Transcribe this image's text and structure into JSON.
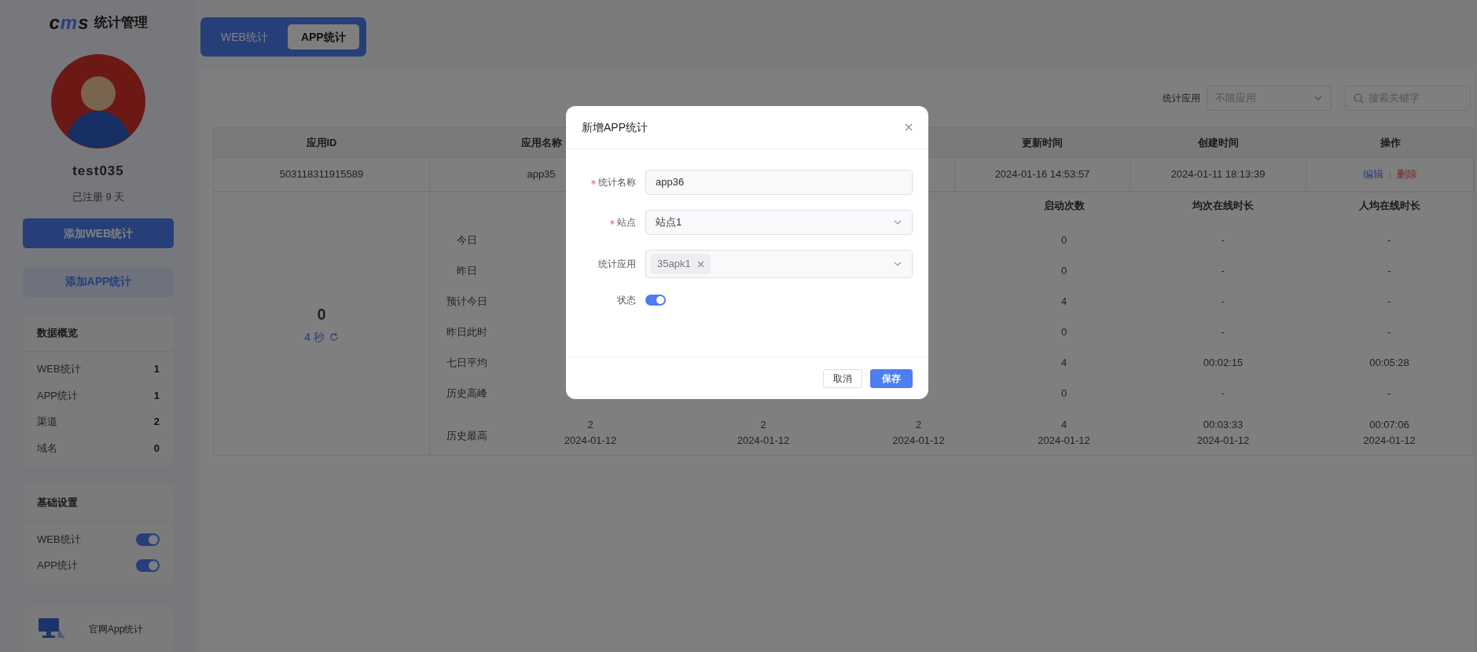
{
  "sidebar": {
    "logo": "cms",
    "title": "统计管理",
    "username": "test035",
    "registered": "已注册 9 天",
    "buttons": [
      {
        "label": "添加WEB统计",
        "kind": "primary"
      },
      {
        "label": "添加APP统计",
        "kind": "light"
      }
    ],
    "overview": {
      "title": "数据概览",
      "items": [
        {
          "label": "WEB统计",
          "value": "1"
        },
        {
          "label": "APP统计",
          "value": "1"
        },
        {
          "label": "渠道",
          "value": "2"
        },
        {
          "label": "域名",
          "value": "0"
        }
      ]
    },
    "settings": {
      "title": "基础设置",
      "items": [
        {
          "label": "WEB统计",
          "on": true
        },
        {
          "label": "APP统计",
          "on": true
        }
      ]
    },
    "footer_link": "官网App统计"
  },
  "tabs": [
    {
      "label": "WEB统计",
      "selected": false
    },
    {
      "label": "APP统计",
      "selected": true
    }
  ],
  "filter": {
    "label": "统计应用",
    "select_placeholder": "不限应用",
    "search_placeholder": "搜索关键字"
  },
  "table": {
    "columns": [
      "应用ID",
      "应用名称",
      "更新时间",
      "创建时间",
      "操作"
    ],
    "rows": [
      {
        "cells": [
          "503118311915589",
          "app35",
          "2024-01-16 14:53:57",
          "2024-01-11 18:13:39"
        ],
        "actions": [
          {
            "label": "编辑",
            "kind": "edit"
          },
          {
            "label": "删除",
            "kind": "delete"
          }
        ]
      }
    ]
  },
  "detail": {
    "online": "0",
    "refresh": "4 秒",
    "headers": [
      "启动次数",
      "均次在线时长",
      "人均在线时长"
    ],
    "rows": [
      {
        "label": "今日",
        "cells": [
          {
            "text": "0"
          },
          {
            "text": "-"
          },
          {
            "text": "-"
          }
        ]
      },
      {
        "label": "昨日",
        "cells": [
          {
            "text": "0"
          },
          {
            "text": "-"
          },
          {
            "text": "-"
          }
        ]
      },
      {
        "label": "预计今日",
        "cells": [
          {
            "text": "4"
          },
          {
            "text": "-"
          },
          {
            "text": "-"
          }
        ]
      },
      {
        "label": "昨日此时",
        "cells": [
          {
            "text": "0"
          },
          {
            "text": "-"
          },
          {
            "text": "-"
          }
        ]
      },
      {
        "label": "七日平均",
        "cells": [
          {
            "text": "4"
          },
          {
            "text": "00:02:15"
          },
          {
            "text": "00:05:28"
          }
        ]
      },
      {
        "label": "历史高峰",
        "cells": [
          {
            "text": "0"
          },
          {
            "text": "-"
          },
          {
            "text": "-"
          }
        ]
      },
      {
        "label": "历史最高",
        "cells": [
          {
            "text": "2",
            "date": "2024-01-12"
          },
          {
            "text": "2",
            "date": "2024-01-12"
          },
          {
            "text": "2",
            "date": "2024-01-12"
          },
          {
            "text": "4",
            "date": "2024-01-12"
          },
          {
            "text": "00:03:33",
            "date": "2024-01-12"
          },
          {
            "text": "00:07:06",
            "date": "2024-01-12"
          }
        ]
      }
    ]
  },
  "modal": {
    "title": "新增APP统计",
    "fields": [
      {
        "label": "统计名称",
        "required": true,
        "kind": "input",
        "value": "app36"
      },
      {
        "label": "站点",
        "required": true,
        "kind": "select",
        "value": "站点1"
      },
      {
        "label": "统计应用",
        "required": false,
        "kind": "tags",
        "tags": [
          "35apk1"
        ]
      },
      {
        "label": "状态",
        "required": false,
        "kind": "switch",
        "on": true
      }
    ],
    "buttons": [
      {
        "label": "取消",
        "kind": "secondary"
      },
      {
        "label": "保存",
        "kind": "primary"
      }
    ]
  }
}
